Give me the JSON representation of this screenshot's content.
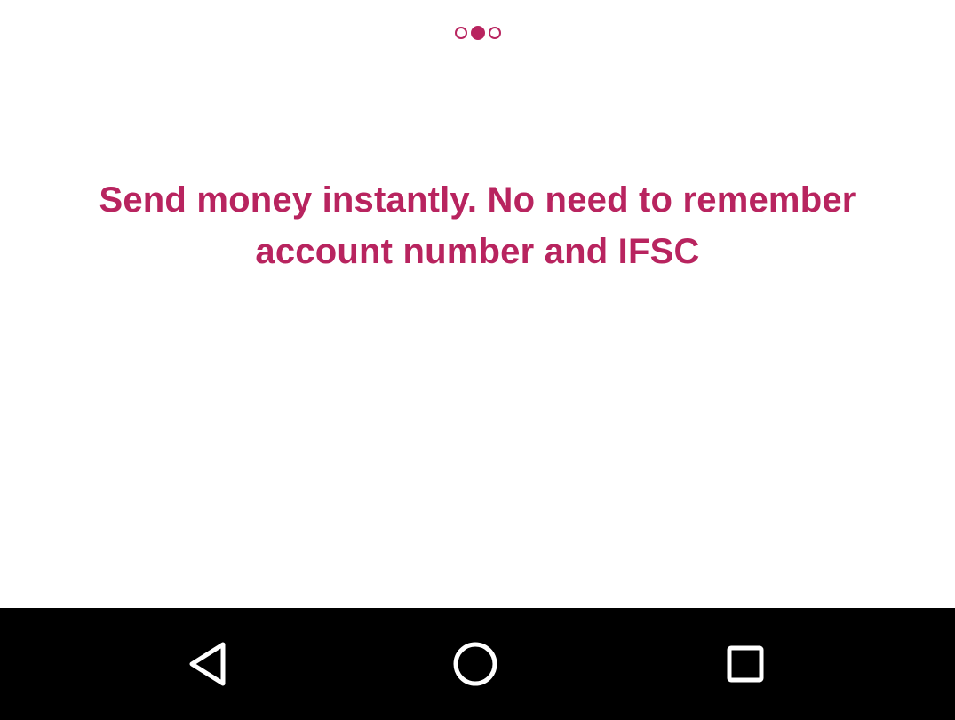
{
  "pager": {
    "pages": [
      {
        "icon": "page-dot-inactive-icon",
        "active": false
      },
      {
        "icon": "page-dot-active-icon",
        "active": true
      },
      {
        "icon": "page-dot-inactive-icon",
        "active": false
      }
    ],
    "current_page": 2,
    "total_pages": 3
  },
  "onboarding": {
    "headline": "Send money instantly. No need to remember account number and IFSC"
  },
  "system_nav": {
    "back_icon": "back-triangle-icon",
    "home_icon": "home-circle-icon",
    "recents_icon": "recents-square-icon"
  },
  "colors": {
    "accent": "#b8245f",
    "background": "#ffffff",
    "nav_bar": "#000000",
    "nav_icon": "#ffffff"
  }
}
